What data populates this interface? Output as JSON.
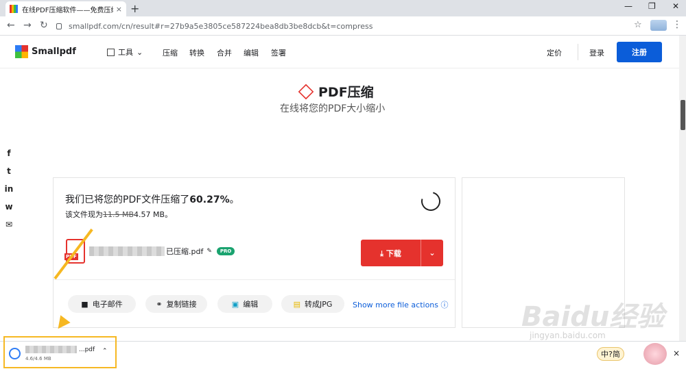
{
  "browser": {
    "tab_title": "在线PDF压缩软件——免费压缩",
    "tab_close": "×",
    "new_tab": "+",
    "min": "—",
    "max": "❐",
    "close": "✕",
    "back": "←",
    "forward": "→",
    "reload": "↻",
    "url": "smallpdf.com/cn/result#r=27b9a5e3805ce587224bea8db3be8dcb&t=compress",
    "star": "☆",
    "menu": "⋮"
  },
  "header": {
    "logo": "Smallpdf",
    "tools": "工具",
    "nav": [
      "压缩",
      "转换",
      "合并",
      "编辑",
      "签署"
    ],
    "pricing": "定价",
    "login": "登录",
    "signup": "注册"
  },
  "hero": {
    "title": "PDF压缩",
    "subtitle": "在线将您的PDF大小缩小"
  },
  "social": [
    "f",
    "t",
    "in",
    "w",
    "✉"
  ],
  "result": {
    "message": "我们已将您的PDF文件压缩了",
    "percent": "60.27%",
    "period": "。",
    "now_prefix": "该文件现为",
    "old_size": "11.5 MB",
    "new_size": "4.57 MB",
    "now_suffix": "。",
    "filename_suffix": "已压缩.pdf",
    "pdf_label": "PDF",
    "pro": "PRO",
    "download": "下载"
  },
  "actions": {
    "email": "电子邮件",
    "copy_link": "复制链接",
    "edit": "编辑",
    "to_jpg": "转成JPG",
    "more": "Show more file actions"
  },
  "download_bar": {
    "file_suffix": "...pdf",
    "size": "4.6/4.6 MB",
    "close": "×"
  },
  "overlay": {
    "ime": "中?简",
    "watermark": "Baidu经验",
    "watermark_url": "jingyan.baidu.com"
  }
}
